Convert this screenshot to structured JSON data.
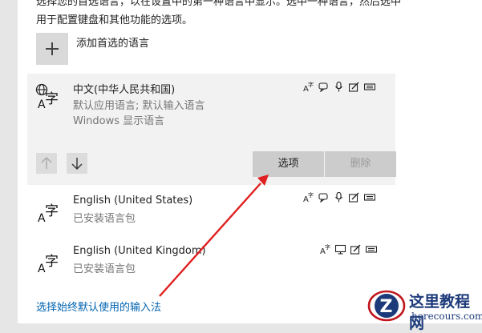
{
  "intro": {
    "line1": "选择您的首选语言，以在设置中的第一种语言中显示。选中一种语言，然后选中",
    "line2": "用于配置键盘和其他功能的选项。"
  },
  "add_language": {
    "label": "添加首选的语言"
  },
  "languages": [
    {
      "name": "中文(中华人民共和国)",
      "sub1": "默认应用语言; 默认输入语言",
      "sub2": "Windows 显示语言",
      "icons": [
        "text-to-speech-icon",
        "speech-icon",
        "microphone-icon",
        "handwriting-icon",
        "keyboard-icon"
      ]
    },
    {
      "name": "English (United States)",
      "sub1": "已安装语言包",
      "icons": [
        "text-to-speech-icon",
        "speech-icon",
        "microphone-icon",
        "handwriting-icon",
        "keyboard-icon"
      ]
    },
    {
      "name": "English (United Kingdom)",
      "sub1": "已安装语言包",
      "icons": [
        "text-to-speech-icon",
        "monitor-icon",
        "handwriting-icon",
        "keyboard-icon"
      ]
    }
  ],
  "buttons": {
    "options": "选项",
    "remove": "删除"
  },
  "link": {
    "label": "选择始终默认使用的输入法"
  },
  "watermark": {
    "title": "这里教程网",
    "url": "herecours.com"
  },
  "colors": {
    "selected_bg": "#f2f2f2",
    "link": "#0063b1",
    "arrow": "#e02020"
  }
}
